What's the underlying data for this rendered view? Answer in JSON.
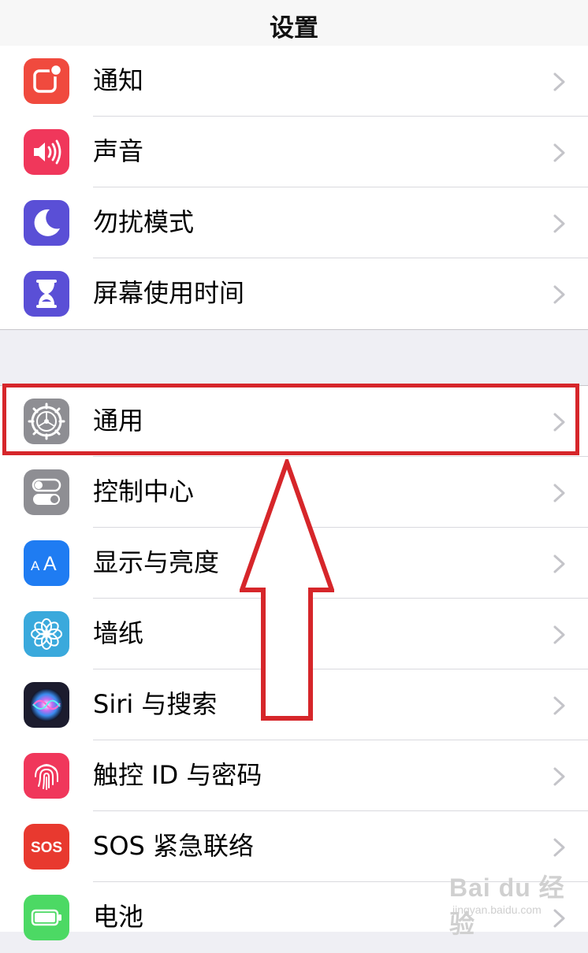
{
  "nav": {
    "title": "设置"
  },
  "group1": [
    {
      "label": "通知",
      "icon": "notifications-icon",
      "color": "#f04a3e"
    },
    {
      "label": "声音",
      "icon": "sound-icon",
      "color": "#f0375b"
    },
    {
      "label": "勿扰模式",
      "icon": "moon-icon",
      "color": "#5a4fd6"
    },
    {
      "label": "屏幕使用时间",
      "icon": "hourglass-icon",
      "color": "#5a4fd6"
    }
  ],
  "group2": [
    {
      "label": "通用",
      "icon": "gear-icon",
      "color": "#8e8e93"
    },
    {
      "label": "控制中心",
      "icon": "toggles-icon",
      "color": "#8e8e93"
    },
    {
      "label": "显示与亮度",
      "icon": "text-size-icon",
      "color": "#1f7cf2"
    },
    {
      "label": "墙纸",
      "icon": "wallpaper-flower-icon",
      "color": "#3aa9dc"
    },
    {
      "label": "Siri 与搜索",
      "icon": "siri-icon",
      "color": "#1c1c2e"
    },
    {
      "label": "触控 ID 与密码",
      "icon": "fingerprint-icon",
      "color": "#f0375b"
    },
    {
      "label": "SOS 紧急联络",
      "icon": "sos-icon",
      "color": "#e8392f",
      "icon_text": "SOS"
    },
    {
      "label": "电池",
      "icon": "battery-icon",
      "color": "#4cd964"
    }
  ],
  "annotation": {
    "highlight_color": "#d6262a"
  },
  "watermark": {
    "main": "Bai du 经验",
    "sub": "jingyan.baidu.com"
  }
}
